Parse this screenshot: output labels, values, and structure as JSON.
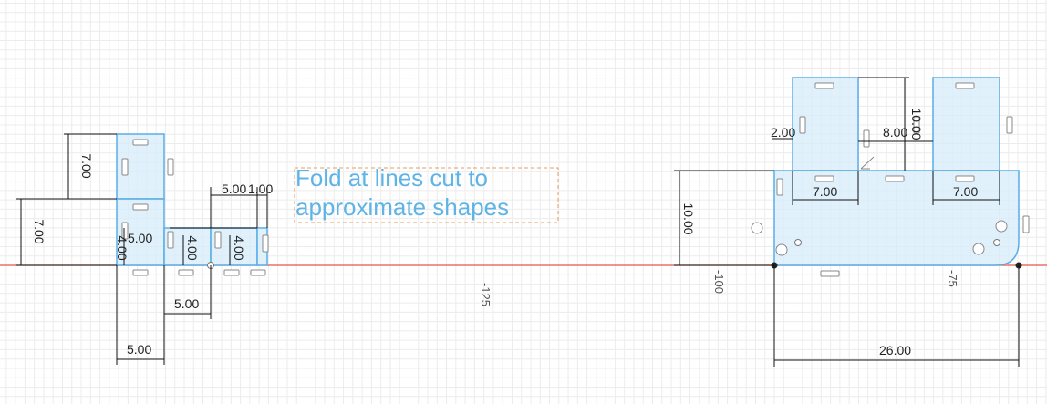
{
  "canvas": {
    "background": "#ffffff",
    "grid_minor": "#ececec",
    "grid_major": "#dcdcdc",
    "axis_color": "#e8534b",
    "sketch_color": "#5aaee6",
    "fill_color": "#d5ecfb"
  },
  "note": {
    "line1": "Fold at lines cut to",
    "line2": "approximate shapes"
  },
  "axis_labels": {
    "a": "-125",
    "b": "-100",
    "c": "-75"
  },
  "left_part": {
    "dims": {
      "h_upper": "7.00",
      "h_lower": "7.00",
      "w_top": "5.00",
      "w_top2": "1.00",
      "h_a": "5.00",
      "h_b": "4.00",
      "h_c": "4.00",
      "h_d": "4.00",
      "w_mid": "5.00",
      "w_bottom": "5.00"
    }
  },
  "right_part": {
    "dims": {
      "h_tab": "10.00",
      "h_body": "10.00",
      "gap_left": "2.00",
      "gap_mid": "8.00",
      "w_tab_left": "7.00",
      "w_tab_right": "7.00",
      "w_total": "26.00"
    }
  }
}
